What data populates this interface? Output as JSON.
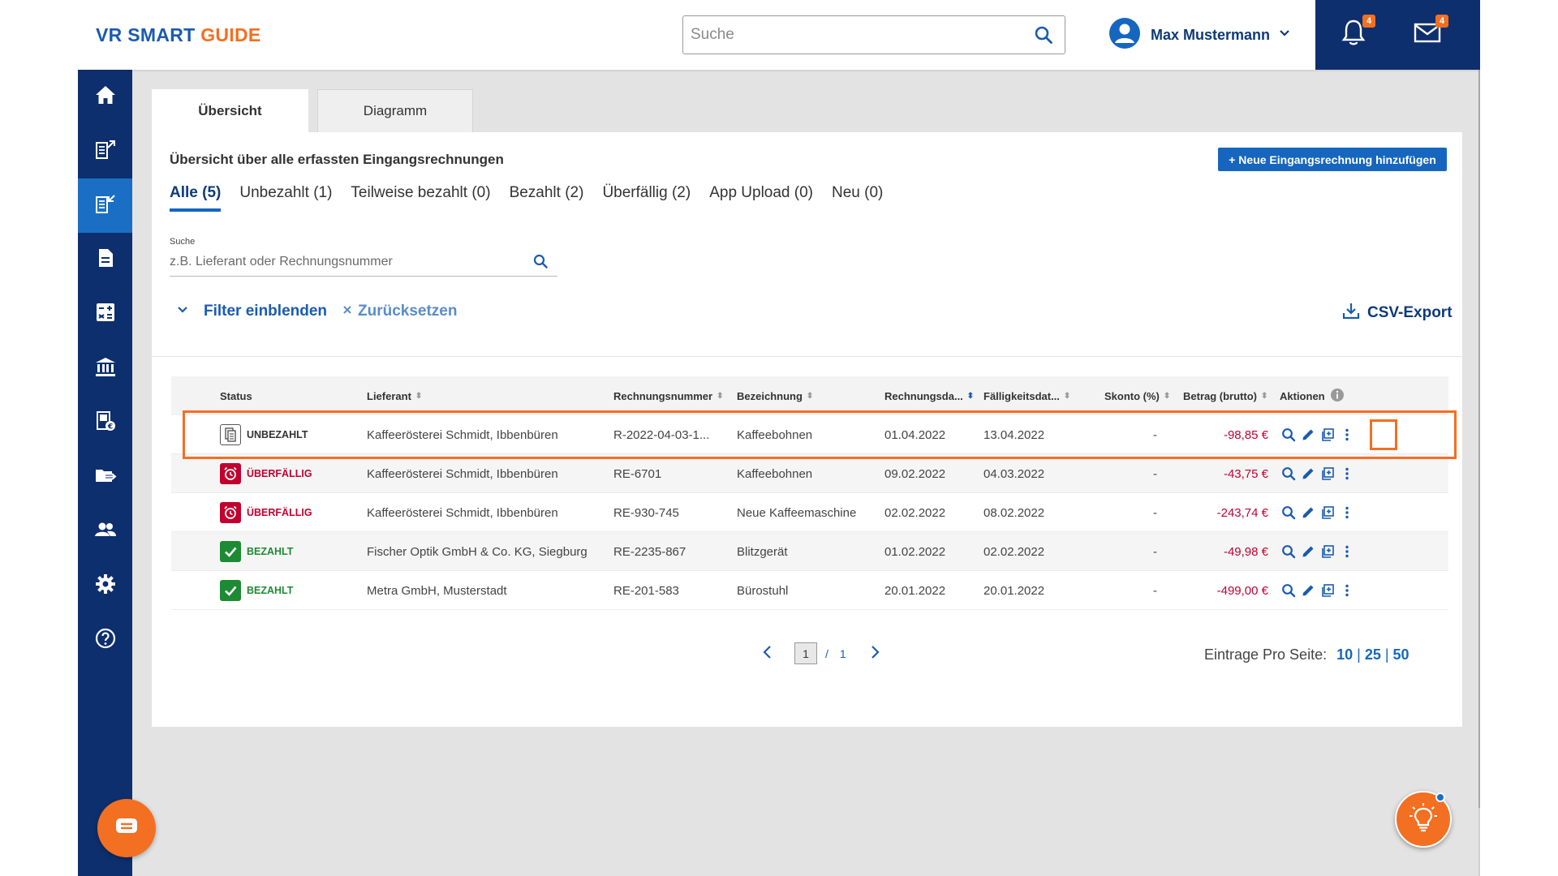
{
  "header": {
    "logo_part1": "VR SMART",
    "logo_part2": "GUIDE",
    "search_placeholder": "Suche",
    "user_name": "Max Mustermann",
    "notifications_count": "4",
    "messages_count": "4"
  },
  "sidebar": {
    "items": [
      {
        "name": "home-icon",
        "active": false
      },
      {
        "name": "outgoing-invoices-icon",
        "active": false
      },
      {
        "name": "incoming-invoices-icon",
        "active": true
      },
      {
        "name": "document-icon",
        "active": false
      },
      {
        "name": "calculator-icon",
        "active": false
      },
      {
        "name": "bank-icon",
        "active": false
      },
      {
        "name": "tax-document-icon",
        "active": false
      },
      {
        "name": "folder-export-icon",
        "active": false
      },
      {
        "name": "users-icon",
        "active": false
      },
      {
        "name": "settings-icon",
        "active": false
      },
      {
        "name": "help-icon",
        "active": false
      }
    ]
  },
  "tabs": [
    {
      "label": "Übersicht",
      "active": true
    },
    {
      "label": "Diagramm",
      "active": false
    }
  ],
  "panel": {
    "title": "Übersicht über alle erfassten Eingangsrechnungen",
    "add_button": "+ Neue Eingangsrechnung hinzufügen",
    "filter_tabs": [
      {
        "label": "Alle (5)",
        "active": true
      },
      {
        "label": "Unbezahlt (1)",
        "active": false
      },
      {
        "label": "Teilweise bezahlt (0)",
        "active": false
      },
      {
        "label": "Bezahlt (2)",
        "active": false
      },
      {
        "label": "Überfällig (2)",
        "active": false
      },
      {
        "label": "App Upload (0)",
        "active": false
      },
      {
        "label": "Neu (0)",
        "active": false
      }
    ],
    "search_label": "Suche",
    "search_placeholder": "z.B. Lieferant oder Rechnungsnummer",
    "filter_toggle": "Filter einblenden",
    "reset": "Zurücksetzen",
    "csv_export": "CSV-Export"
  },
  "table": {
    "columns": {
      "status": "Status",
      "supplier": "Lieferant",
      "invoice_number": "Rechnungsnummer",
      "description": "Bezeichnung",
      "invoice_date": "Rechnungsda...",
      "due_date": "Fälligkeitsdat...",
      "discount": "Skonto (%)",
      "amount": "Betrag (brutto)",
      "actions": "Aktionen"
    },
    "rows": [
      {
        "status": "UNBEZAHLT",
        "status_type": "unpaid",
        "supplier": "Kaffeerösterei Schmidt, Ibbenbüren",
        "invoice_number": "R-2022-04-03-1...",
        "description": "Kaffeebohnen",
        "invoice_date": "01.04.2022",
        "due_date": "13.04.2022",
        "discount": "-",
        "amount": "-98,85 €"
      },
      {
        "status": "ÜBERFÄLLIG",
        "status_type": "overdue",
        "supplier": "Kaffeerösterei Schmidt, Ibbenbüren",
        "invoice_number": "RE-6701",
        "description": "Kaffeebohnen",
        "invoice_date": "09.02.2022",
        "due_date": "04.03.2022",
        "discount": "-",
        "amount": "-43,75 €"
      },
      {
        "status": "ÜBERFÄLLIG",
        "status_type": "overdue",
        "supplier": "Kaffeerösterei Schmidt, Ibbenbüren",
        "invoice_number": "RE-930-745",
        "description": "Neue Kaffeemaschine",
        "invoice_date": "02.02.2022",
        "due_date": "08.02.2022",
        "discount": "-",
        "amount": "-243,74 €"
      },
      {
        "status": "BEZAHLT",
        "status_type": "paid",
        "supplier": "Fischer Optik GmbH & Co. KG, Siegburg",
        "invoice_number": "RE-2235-867",
        "description": "Blitzgerät",
        "invoice_date": "01.02.2022",
        "due_date": "02.02.2022",
        "discount": "-",
        "amount": "-49,98 €"
      },
      {
        "status": "BEZAHLT",
        "status_type": "paid",
        "supplier": "Metra GmbH, Musterstadt",
        "invoice_number": "RE-201-583",
        "description": "Bürostuhl",
        "invoice_date": "20.01.2022",
        "due_date": "20.01.2022",
        "discount": "-",
        "amount": "-499,00 €"
      }
    ]
  },
  "pagination": {
    "current": "1",
    "separator": "/",
    "total": "1",
    "per_page_label": "Eintrage Pro Seite:",
    "per_page_options": [
      "10",
      "25",
      "50"
    ]
  },
  "colors": {
    "brand_blue": "#1a5bb0",
    "brand_orange": "#f36f21",
    "nav_dark": "#0e2f6e",
    "overdue_red": "#c2002f",
    "paid_green": "#1d8a34"
  }
}
